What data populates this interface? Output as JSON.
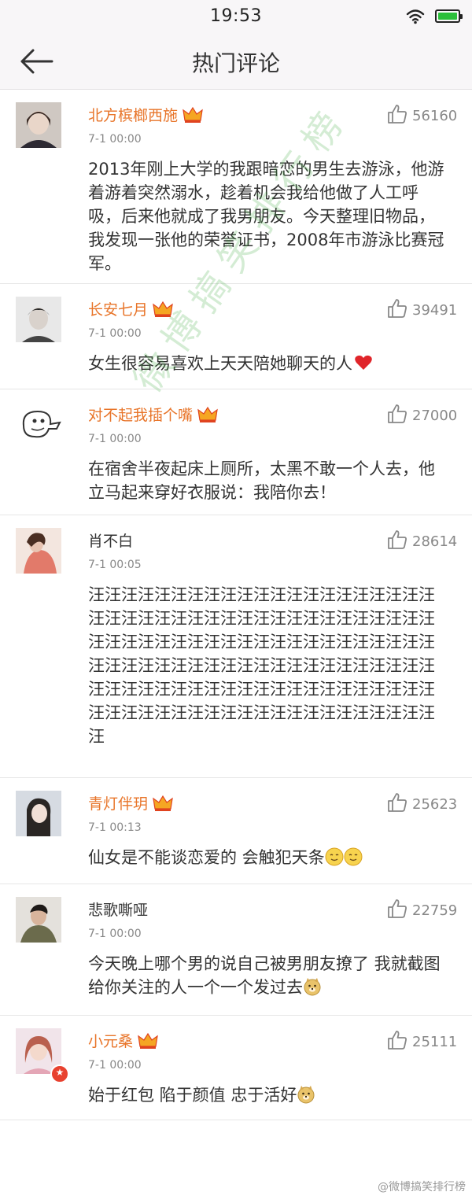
{
  "status_bar": {
    "time": "19:53"
  },
  "nav": {
    "title": "热门评论"
  },
  "comments": [
    {
      "name": "北方槟榔西施",
      "time": "7-1 00:00",
      "likes": "56160",
      "text": "2013年刚上大学的我跟暗恋的男生去游泳，他游着游着突然溺水，趁着机会我给他做了人工呼吸，后来他就成了我男朋友。今天整理旧物品，我发现一张他的荣誉证书，2008年市游泳比赛冠军。"
    },
    {
      "name": "长安七月",
      "time": "7-1 00:00",
      "likes": "39491",
      "text": "女生很容易喜欢上天天陪她聊天的人"
    },
    {
      "name": "对不起我插个嘴",
      "time": "7-1 00:00",
      "likes": "27000",
      "text": "在宿舍半夜起床上厕所，太黑不敢一个人去，他立马起来穿好衣服说：我陪你去！"
    },
    {
      "name": "肖不白",
      "time": "7-1 00:05",
      "likes": "28614",
      "text": "汪汪汪汪汪汪汪汪汪汪汪汪汪汪汪汪汪汪汪汪汪汪汪汪汪汪汪汪汪汪汪汪汪汪汪汪汪汪汪汪汪汪汪汪汪汪汪汪汪汪汪汪汪汪汪汪汪汪汪汪汪汪汪汪汪汪汪汪汪汪汪汪汪汪汪汪汪汪汪汪汪汪汪汪汪汪汪汪汪汪汪汪汪汪汪汪汪汪汪汪汪汪汪汪汪汪汪汪汪汪汪汪汪汪汪汪汪汪汪汪汪汪汪汪汪汪汪"
    },
    {
      "name": "青灯伴玥",
      "time": "7-1 00:13",
      "likes": "25623",
      "text": "仙女是不能谈恋爱的  会触犯天条"
    },
    {
      "name": "悲歌嘶哑",
      "time": "7-1 00:00",
      "likes": "22759",
      "text": "今天晚上哪个男的说自己被男朋友撩了 我就截图给你关注的人一个一个发过去"
    },
    {
      "name": "小元桑",
      "time": "7-1 00:00",
      "likes": "25111",
      "text": "始于红包  陷于颜值  忠于活好"
    }
  ],
  "watermark": "微博搞笑排行榜",
  "source_label": "@微博搞笑排行榜",
  "colors": {
    "vip_name": "#e8752a",
    "crown": "#f5a623",
    "verified_badge": "#e8412f",
    "heart": "#e0252a"
  },
  "icons": {
    "back": "back-arrow-icon",
    "like": "thumbs-up-icon",
    "vip": "crown-icon",
    "wifi": "wifi-icon",
    "battery": "battery-icon"
  }
}
